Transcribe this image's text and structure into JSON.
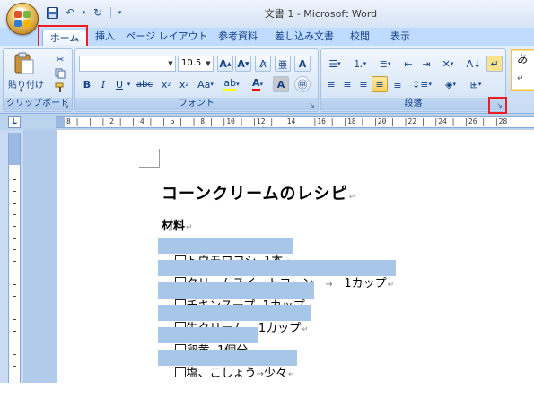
{
  "window": {
    "title": "文書 1 - Microsoft Word"
  },
  "tabs": [
    {
      "label": "ホーム",
      "active": true,
      "highlighted": true
    },
    {
      "label": "挿入"
    },
    {
      "label": "ページ レイアウト"
    },
    {
      "label": "参考資料"
    },
    {
      "label": "差し込み文書"
    },
    {
      "label": "校閲"
    },
    {
      "label": "表示"
    }
  ],
  "ribbon": {
    "clipboard": {
      "paste_label": "貼り付け",
      "group_label": "クリップボード"
    },
    "font": {
      "font_name": "",
      "font_size": "10.5",
      "group_label": "フォント"
    },
    "paragraph": {
      "group_label": "段落",
      "launcher_highlighted": true
    },
    "styles": {
      "preview_text": "あ"
    }
  },
  "ruler": {
    "corner_label": "L",
    "numbers": "8 |  |  | 2 |  | 4 |  | 6 |  | 8 |  |10 |  |12 |  |14 |  |16 |  |18 |  |20 |  |22 |  |24 |  |26 |  |28"
  },
  "document": {
    "title": "コーンクリームのレシピ",
    "section_heading": "材料",
    "items": [
      {
        "text": "トウモロコシ",
        "arrow": "→",
        "amount": "1本"
      },
      {
        "text": "クリームスイートコーン",
        "arrow": "    →    ",
        "amount": "1カップ"
      },
      {
        "text": "チキンスープ",
        "arrow": "→",
        "amount": "1カップ"
      },
      {
        "text": "生クリーム ",
        "arrow": "→ ",
        "amount": "1カップ"
      },
      {
        "text": "卵黄",
        "arrow": "→",
        "amount": "1個分"
      },
      {
        "text": "塩、こしょう",
        "arrow": "→",
        "amount": "少々"
      }
    ]
  },
  "colors": {
    "highlight_box": "#ee1c25",
    "selection": "#a7c6e8",
    "ribbon_text": "#15428b"
  }
}
